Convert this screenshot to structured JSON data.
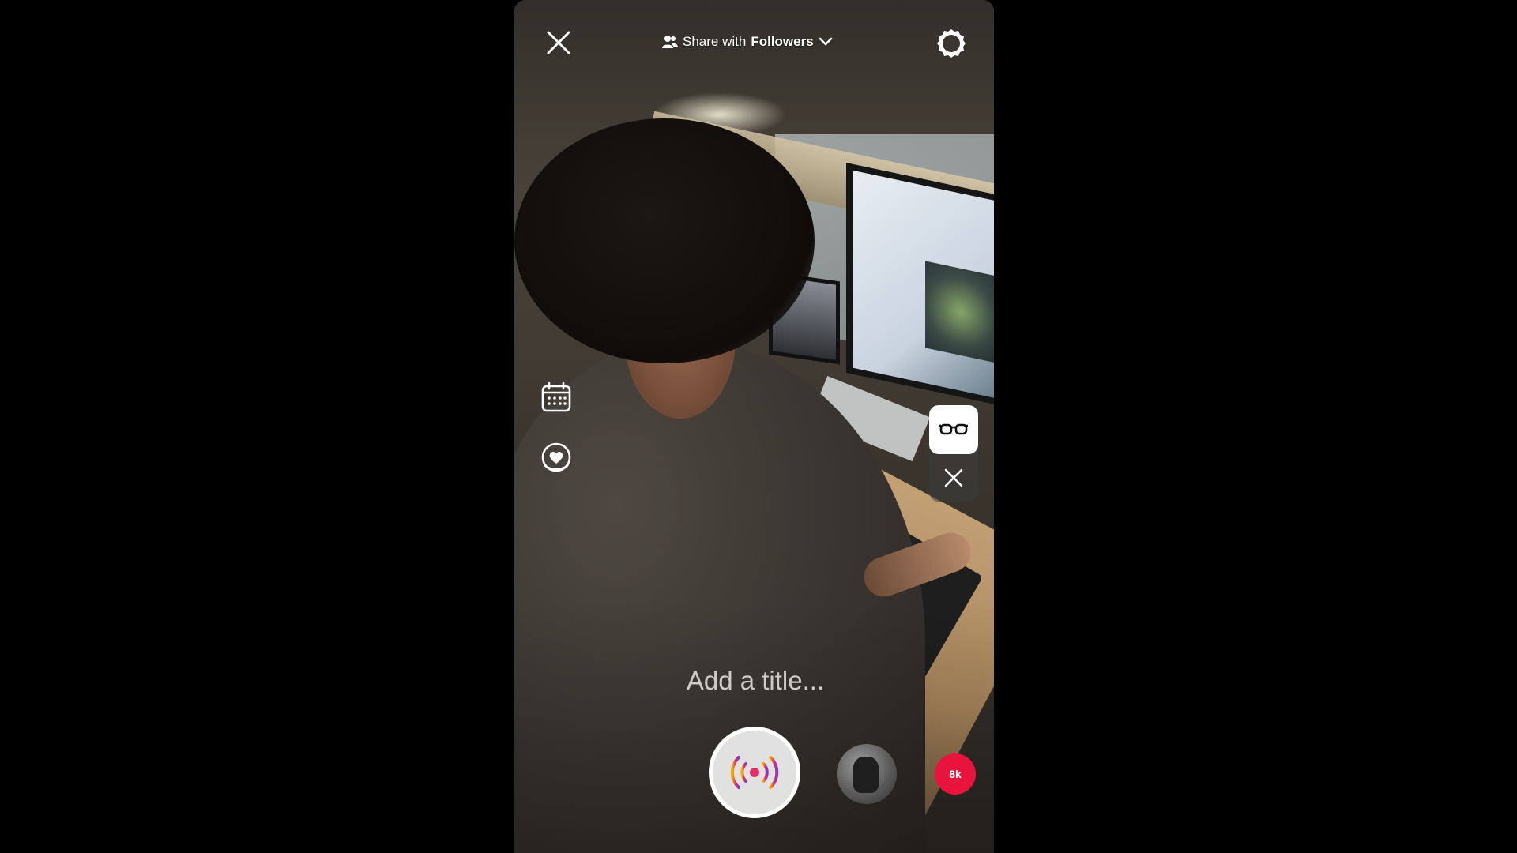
{
  "header": {
    "close_icon": "close-icon",
    "share_prefix": "Share with",
    "share_audience": "Followers",
    "share_icon": "people-icon",
    "dropdown_icon": "chevron-down-icon",
    "settings_icon": "settings-icon"
  },
  "left_tools": [
    {
      "name": "schedule",
      "icon": "calendar-icon"
    },
    {
      "name": "fundraiser",
      "icon": "heart-badge-icon"
    }
  ],
  "effect_panel": {
    "active_effect_icon": "glasses-icon",
    "close_icon": "close-icon"
  },
  "title_input": {
    "placeholder": "Add a title...",
    "value": ""
  },
  "controls": {
    "go_live_icon": "live-broadcast-icon",
    "guest_avatar": "avatar",
    "viewer_count": "8k"
  },
  "colors": {
    "badge": "#e8143e",
    "live_gradient_start": "#f7b500",
    "live_gradient_mid": "#e1306c",
    "live_gradient_end": "#833ab4"
  }
}
